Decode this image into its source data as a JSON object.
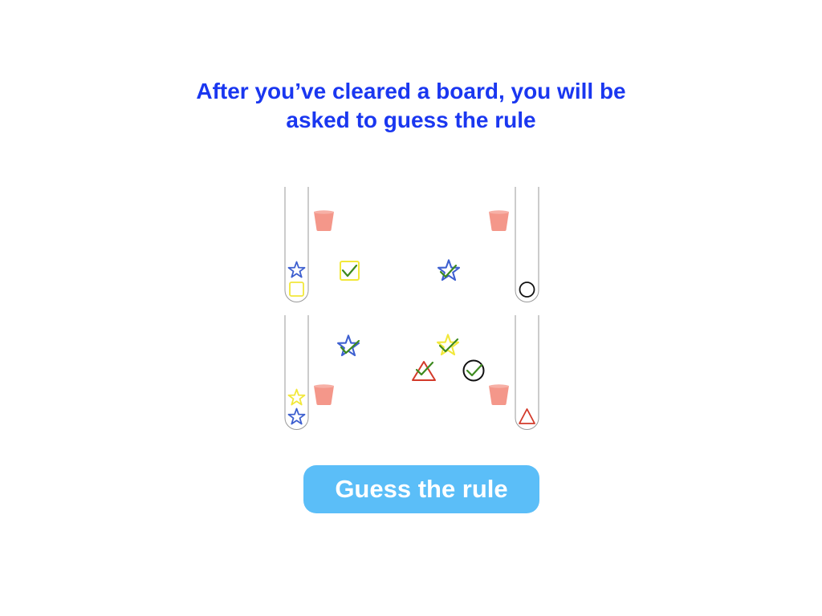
{
  "instruction": {
    "line1": "After you’ve cleared a board, you will be",
    "line2": "asked to guess the rule"
  },
  "guess_button": {
    "label": "Guess the rule"
  },
  "colors": {
    "instruction_text": "#1a37f0",
    "button_bg": "#5bbef8",
    "button_text": "#ffffff",
    "bucket": "#f4978a",
    "blue_shape": "#3d5fd0",
    "yellow_shape": "#f2e83a",
    "red_shape": "#d33a2a",
    "black_shape": "#111111",
    "checkmark": "#3d8a1f",
    "tube_outline": "#9a9a9a"
  },
  "boards": [
    {
      "left_tube": [
        "blue-star",
        "yellow-square"
      ],
      "right_tube": [
        "black-circle"
      ],
      "cleared_items": [
        "yellow-square",
        "blue-star"
      ]
    },
    {
      "left_tube": [
        "yellow-star",
        "blue-star"
      ],
      "right_tube": [
        "red-triangle"
      ],
      "cleared_items": [
        "blue-star",
        "yellow-star",
        "red-triangle",
        "black-circle"
      ]
    }
  ]
}
